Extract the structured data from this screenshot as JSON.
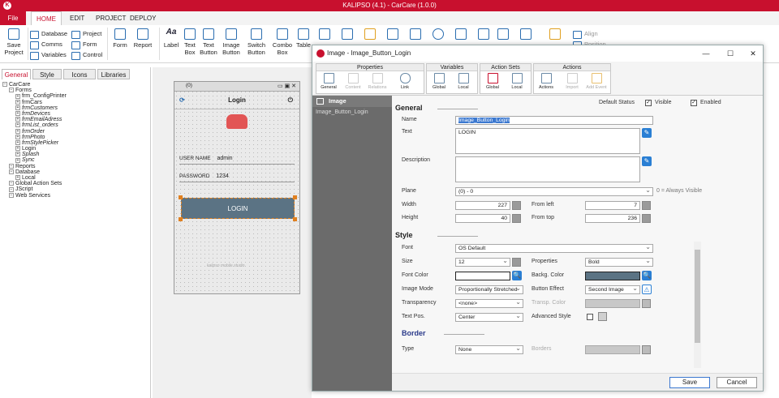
{
  "app": {
    "title": "KALIPSO (4.1)  -  CarCare (1.0.0)"
  },
  "menu": {
    "file": "File",
    "home": "HOME",
    "edit": "EDIT",
    "project": "PROJECT",
    "deploy": "DEPLOY"
  },
  "ribbon": {
    "save": "Save Project",
    "database": "Database",
    "comms": "Comms",
    "variables": "Variables",
    "project": "Project",
    "form": "Form",
    "control": "Control",
    "form2": "Form",
    "report": "Report",
    "label": "Label",
    "textbox": "Text Box",
    "textbutton": "Text Button",
    "imagebutton": "Image Button",
    "switchbutton": "Switch Button",
    "combobox": "Combo Box",
    "table": "Table",
    "align": "Align",
    "position": "Position"
  },
  "leftpanel": {
    "tabs": [
      "General",
      "Style",
      "Icons",
      "Libraries"
    ],
    "tree": [
      {
        "label": "CarCare",
        "indent": 0,
        "italic": false
      },
      {
        "label": "Forms",
        "indent": 1,
        "italic": false
      },
      {
        "label": "frm_ConfigPrinter",
        "indent": 2,
        "italic": false
      },
      {
        "label": "frmCars",
        "indent": 2,
        "italic": false
      },
      {
        "label": "frmCustomers",
        "indent": 2,
        "italic": true
      },
      {
        "label": "frmDevices",
        "indent": 2,
        "italic": true
      },
      {
        "label": "frmEmailAdress",
        "indent": 2,
        "italic": true
      },
      {
        "label": "frmList_orders",
        "indent": 2,
        "italic": true
      },
      {
        "label": "frmOrder",
        "indent": 2,
        "italic": true
      },
      {
        "label": "frmPhoto",
        "indent": 2,
        "italic": true
      },
      {
        "label": "frmStylePicker",
        "indent": 2,
        "italic": true
      },
      {
        "label": "Login",
        "indent": 2,
        "italic": false
      },
      {
        "label": "Splash",
        "indent": 2,
        "italic": true
      },
      {
        "label": "Sync",
        "indent": 2,
        "italic": true
      },
      {
        "label": "Reports",
        "indent": 1,
        "italic": false
      },
      {
        "label": "Database",
        "indent": 1,
        "italic": false
      },
      {
        "label": "Local",
        "indent": 2,
        "italic": false
      },
      {
        "label": "Global Action Sets",
        "indent": 1,
        "italic": false
      },
      {
        "label": "JScript",
        "indent": 1,
        "italic": false
      },
      {
        "label": "Web Services",
        "indent": 1,
        "italic": false
      }
    ]
  },
  "phone": {
    "bar_label": "(0)",
    "title": "Login",
    "username_label": "USER NAME",
    "username_value": "admin",
    "password_label": "PASSWORD",
    "password_value": "1234",
    "login_button": "LOGIN",
    "footer": "kalipso mobile studio"
  },
  "dialog": {
    "title": "Image - Image_Button_Login",
    "groups": [
      "Properties",
      "Variables",
      "Action Sets",
      "Actions"
    ],
    "tools": [
      "General",
      "Content",
      "Relations",
      "Link",
      "Global",
      "Local",
      "Global",
      "Local",
      "Actions",
      "Import",
      "Add Event"
    ],
    "left_header": "Image",
    "left_item": "Image_Button_Login",
    "default_status": "Default Status",
    "visible": "Visible",
    "enabled": "Enabled",
    "general_section": "General",
    "name_label": "Name",
    "name_value": "Image_Button_Login",
    "text_label": "Text",
    "text_value": "LOGIN",
    "description_label": "Description",
    "plane_label": "Plane",
    "plane_value": "(0)  - 0",
    "plane_hint": "0 = Always Visible",
    "width_label": "Width",
    "width_value": "227",
    "height_label": "Height",
    "height_value": "40",
    "fromleft_label": "From left",
    "fromleft_value": "7",
    "fromtop_label": "From top",
    "fromtop_value": "236",
    "style_section": "Style",
    "font_label": "Font",
    "font_value": "OS Default",
    "size_label": "Size",
    "size_value": "12",
    "properties_label": "Properties",
    "properties_value": "Bold",
    "fontcolor_label": "Font Color",
    "backcolor_label": "Backg. Color",
    "backcolor_value": "#5b7384",
    "imagemode_label": "Image Mode",
    "imagemode_value": "Proportionally Stretched",
    "buttoneffect_label": "Button Effect",
    "buttoneffect_value": "Second Image",
    "transparency_label": "Transparency",
    "transparency_value": "<none>",
    "transpcolor_label": "Transp. Color",
    "textpos_label": "Text Pos.",
    "textpos_value": "Center",
    "advstyle_label": "Advanced Style",
    "border_section": "Border",
    "type_label": "Type",
    "type_value": "None",
    "borders_label": "Borders",
    "save_button": "Save",
    "cancel_button": "Cancel"
  },
  "colors": {
    "brand": "#c8102e",
    "button": "#5b7384",
    "accent": "#2a6db0"
  }
}
